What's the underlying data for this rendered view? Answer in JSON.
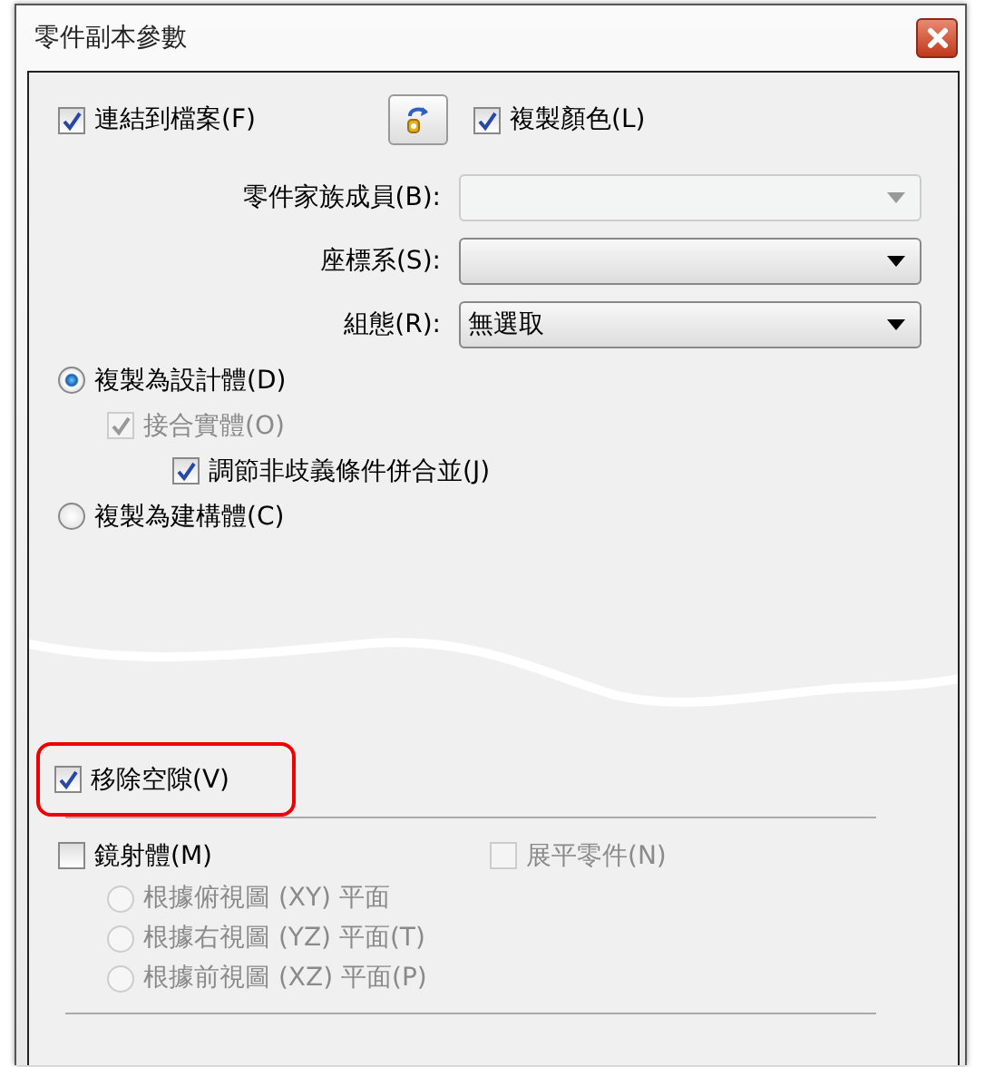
{
  "window": {
    "title": "零件副本參數"
  },
  "top_options": [
    {
      "kind": "checkbox",
      "label": "連結到檔案(F)",
      "checked": true
    },
    {
      "kind": "icon_button"
    },
    {
      "kind": "checkbox",
      "label": "複製顏色(L)",
      "checked": true
    }
  ],
  "dropdowns": [
    {
      "label": "零件家族成員(B):",
      "disabled": true
    },
    {
      "label": "座標系(S):",
      "disabled": false
    },
    {
      "label": "組態(R):",
      "value": "無選取",
      "disabled": false
    }
  ],
  "copy_modes": [
    {
      "label": "複製為設計體(D)",
      "selected": true,
      "children": [
        {
          "label": "接合實體(O)",
          "checked": true,
          "disabled": true,
          "children": [
            {
              "label": "調節非歧義條件併合並(J)",
              "checked": true,
              "disabled": false
            }
          ]
        }
      ]
    },
    {
      "label": "複製為建構體(C)",
      "selected": false
    }
  ],
  "remove_gaps": {
    "label": "移除空隙(V)",
    "checked": true,
    "highlighted": true
  },
  "mirror": {
    "label": "鏡射體(M)",
    "checked": false,
    "disabled": false
  },
  "flatten": {
    "label": "展平零件(N)",
    "checked": false,
    "disabled": true
  },
  "mirror_planes": [
    {
      "label": "根據俯視圖 (XY) 平面",
      "selected": false,
      "disabled": true
    },
    {
      "label": "根據右視圖 (YZ) 平面(T)",
      "selected": false,
      "disabled": true
    },
    {
      "label": "根據前視圖 (XZ) 平面(P)",
      "selected": false,
      "disabled": true
    }
  ]
}
